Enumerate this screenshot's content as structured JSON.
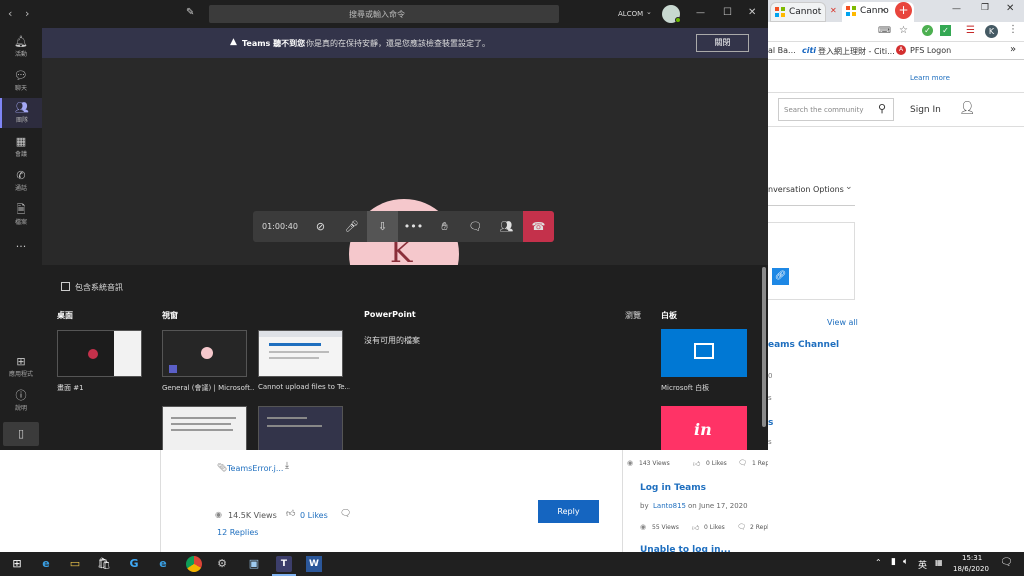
{
  "browser": {
    "tabs": [
      {
        "label": "Cannot"
      },
      {
        "label": "Canno"
      }
    ],
    "tab_overflow": "...",
    "bookmarks": [
      "al Ba...",
      "登入網上理財 - Citi...",
      "PFS Logon"
    ],
    "citi_label": "citi",
    "profile_initial": "K"
  },
  "site": {
    "learn_more": "Learn more",
    "search_placeholder": "Search the community",
    "sign_in": "Sign In",
    "conversation_options": "nversation Options",
    "view_all": "View all",
    "related": [
      {
        "title": "eams Channel",
        "number": "0"
      },
      {
        "title": "s"
      }
    ],
    "post1_stats": {
      "views": "143 Views",
      "likes": "0 Likes",
      "replies": "1 Replies"
    },
    "post2": {
      "title": "Log in Teams",
      "by": "by",
      "author": "Lanto815",
      "date": "on June 17, 2020",
      "views": "55 Views",
      "likes": "0 Likes",
      "replies": "2 Replies"
    },
    "post3_partial": "Unable to log in..."
  },
  "article": {
    "attachment": "TeamsError.j...",
    "views": "14.5K Views",
    "likes": "0 Likes",
    "replies": "12 Replies",
    "reply_button": "Reply"
  },
  "teams": {
    "search_placeholder": "搜尋或輸入命令",
    "org": "ALCOM",
    "banner": {
      "title": "Teams 聽不到您",
      "message": "你是真的在保持安靜，還是您應該檢查裝置設定了。",
      "close_button": "關閉"
    },
    "rail": [
      {
        "label": "活動",
        "icon": "bell-icon"
      },
      {
        "label": "聊天",
        "icon": "chat-icon"
      },
      {
        "label": "團隊",
        "icon": "team-icon"
      },
      {
        "label": "會議",
        "icon": "calendar-icon"
      },
      {
        "label": "通話",
        "icon": "phone-icon"
      },
      {
        "label": "檔案",
        "icon": "file-icon"
      },
      {
        "label": "...",
        "icon": "more-icon"
      }
    ],
    "rail_bottom": [
      {
        "label": "應用程式",
        "icon": "apps-icon"
      },
      {
        "label": "說明",
        "icon": "help-icon"
      }
    ],
    "avatar_initial": "K",
    "call_timer": "01:00:40",
    "share": {
      "include_sound": "包含系統音訊",
      "desktop_header": "桌面",
      "desktop_item": "畫面 #1",
      "window_header": "視窗",
      "window_items": [
        "General (會議) | Microsoft...",
        "Cannot upload files to Te..."
      ],
      "powerpoint_header": "PowerPoint",
      "no_files": "沒有可用的檔案",
      "browse": "瀏覽",
      "whiteboard_header": "白板",
      "whiteboard_item": "Microsoft 白板",
      "invision_label": "in"
    },
    "colors": {
      "hangup": "#c4314b",
      "banner": "#33344a",
      "whiteboard": "#0078d4",
      "invision": "#ff3366"
    }
  },
  "taskbar": {
    "ime": "英",
    "time": "15:31",
    "date": "18/6/2020"
  }
}
